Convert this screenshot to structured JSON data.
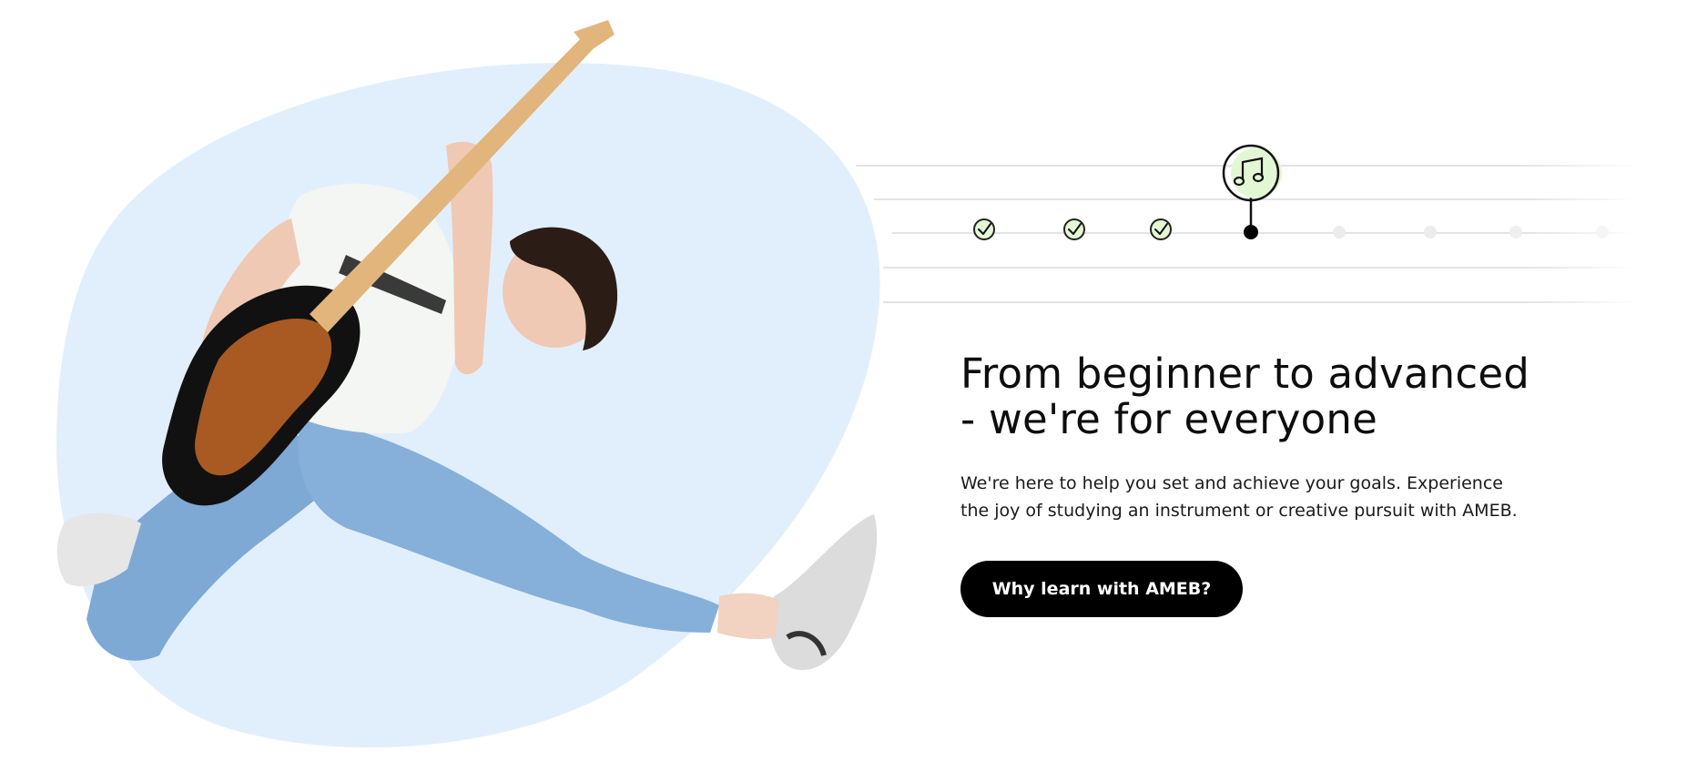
{
  "hero": {
    "headline_line1": "From beginner to advanced",
    "headline_line2": "- we're for everyone",
    "body_line1": "We're here to help you set and achieve your goals. Experience",
    "body_line2": "the joy of studying an instrument or creative pursuit with AMEB.",
    "cta_label": "Why learn with AMEB?"
  },
  "progress": {
    "completed_steps": 3,
    "current_step": 4,
    "total_steps": 8,
    "current_icon": "music-note-icon",
    "completed_icon": "check-icon"
  },
  "image": {
    "subject": "guitarist-jumping-photo"
  },
  "colors": {
    "blob": "#e1effd",
    "check_fill": "#e4f7d4",
    "cta_bg": "#000000",
    "cta_text": "#ffffff",
    "staff_line": "#e3e3e3",
    "pending_dot": "#ececec"
  }
}
